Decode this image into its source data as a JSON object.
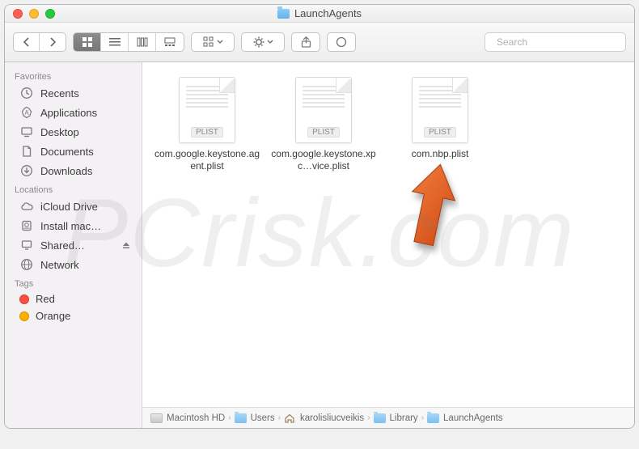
{
  "window": {
    "title": "LaunchAgents"
  },
  "toolbar": {
    "search_placeholder": "Search"
  },
  "sidebar": {
    "sections": [
      {
        "title": "Favorites",
        "items": [
          {
            "label": "Recents",
            "icon": "clock-icon"
          },
          {
            "label": "Applications",
            "icon": "app-icon"
          },
          {
            "label": "Desktop",
            "icon": "desktop-icon"
          },
          {
            "label": "Documents",
            "icon": "document-icon"
          },
          {
            "label": "Downloads",
            "icon": "download-icon"
          }
        ]
      },
      {
        "title": "Locations",
        "items": [
          {
            "label": "iCloud Drive",
            "icon": "cloud-icon"
          },
          {
            "label": "Install mac…",
            "icon": "disk-icon"
          },
          {
            "label": "Shared…",
            "icon": "computer-icon",
            "eject": true
          },
          {
            "label": "Network",
            "icon": "globe-icon"
          }
        ]
      },
      {
        "title": "Tags",
        "items": [
          {
            "label": "Red",
            "icon": "tag-red"
          },
          {
            "label": "Orange",
            "icon": "tag-orange"
          }
        ]
      }
    ]
  },
  "files": [
    {
      "name": "com.google.keystone.agent.plist",
      "badge": "PLIST"
    },
    {
      "name": "com.google.keystone.xpc…vice.plist",
      "badge": "PLIST"
    },
    {
      "name": "com.nbp.plist",
      "badge": "PLIST"
    }
  ],
  "path": [
    {
      "label": "Macintosh HD",
      "kind": "hd"
    },
    {
      "label": "Users",
      "kind": "folder"
    },
    {
      "label": "karolisliucveikis",
      "kind": "home"
    },
    {
      "label": "Library",
      "kind": "folder"
    },
    {
      "label": "LaunchAgents",
      "kind": "folder"
    }
  ],
  "watermark": "PCrisk.com"
}
